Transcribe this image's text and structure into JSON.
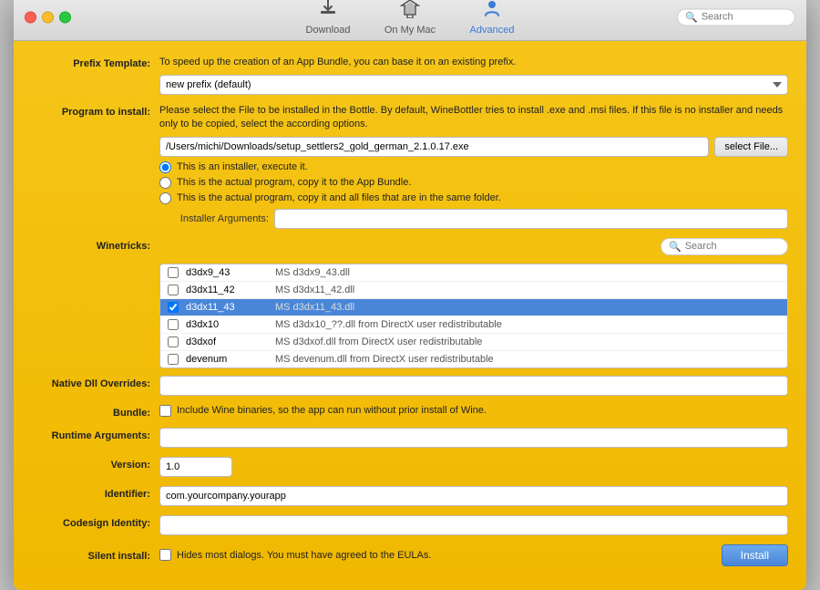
{
  "window": {
    "traffic_lights": [
      "close",
      "minimize",
      "maximize"
    ],
    "search_placeholder": "Search"
  },
  "toolbar": {
    "items": [
      {
        "id": "download",
        "label": "Download",
        "icon": "⬇",
        "active": false
      },
      {
        "id": "on-my-mac",
        "label": "On My Mac",
        "icon": "✦",
        "active": false
      },
      {
        "id": "advanced",
        "label": "Advanced",
        "icon": "👤",
        "active": true
      }
    ]
  },
  "form": {
    "prefix_template": {
      "label": "Prefix Template:",
      "description": "To speed up the creation of an App Bundle, you can base it on an existing prefix.",
      "value": "new prefix (default)"
    },
    "program_to_install": {
      "label": "Program to install:",
      "description": "Please select the File to be installed in the Bottle. By default, WineBottler tries to install .exe and .msi files. If this file is no installer and needs only to be copied, select the according options.",
      "file_path": "/Users/michi/Downloads/setup_settlers2_gold_german_2.1.0.17.exe",
      "select_file_btn": "select File...",
      "radio_options": [
        {
          "id": "installer",
          "label": "This is an installer, execute it.",
          "checked": true
        },
        {
          "id": "copy",
          "label": "This is the actual program, copy it to the App Bundle.",
          "checked": false
        },
        {
          "id": "copy-folder",
          "label": "This is the actual program, copy it and all files that are in the same folder.",
          "checked": false
        }
      ],
      "installer_args_label": "Installer Arguments:",
      "installer_args_value": ""
    },
    "winetricks": {
      "label": "Winetricks:",
      "search_placeholder": "Search",
      "items": [
        {
          "id": "d3dx9_43",
          "name": "d3dx9_43",
          "desc": "MS d3dx9_43.dll",
          "checked": false,
          "selected": false
        },
        {
          "id": "d3dx11_42",
          "name": "d3dx11_42",
          "desc": "MS d3dx11_42.dll",
          "checked": false,
          "selected": false
        },
        {
          "id": "d3dx11_43",
          "name": "d3dx11_43",
          "desc": "MS d3dx11_43.dll",
          "checked": true,
          "selected": true
        },
        {
          "id": "d3dx10",
          "name": "d3dx10",
          "desc": "MS d3dx10_??.dll from DirectX user redistributable",
          "checked": false,
          "selected": false
        },
        {
          "id": "d3dxof",
          "name": "d3dxof",
          "desc": "MS d3dxof.dll from DirectX user redistributable",
          "checked": false,
          "selected": false
        },
        {
          "id": "devenum",
          "name": "devenum",
          "desc": "MS devenum.dll from DirectX user redistributable",
          "checked": false,
          "selected": false
        }
      ]
    },
    "native_dll": {
      "label": "Native Dll Overrides:",
      "value": ""
    },
    "bundle": {
      "label": "Bundle:",
      "description": "Include Wine binaries, so the app can run without prior install of Wine.",
      "checked": false
    },
    "runtime_arguments": {
      "label": "Runtime Arguments:",
      "value": ""
    },
    "version": {
      "label": "Version:",
      "value": "1.0"
    },
    "identifier": {
      "label": "Identifier:",
      "value": "com.yourcompany.yourapp"
    },
    "codesign_identity": {
      "label": "Codesign Identity:",
      "value": ""
    },
    "silent_install": {
      "label": "Silent install:",
      "description": "Hides most dialogs. You must have agreed to the EULAs.",
      "checked": false
    },
    "install_btn": "Install"
  }
}
